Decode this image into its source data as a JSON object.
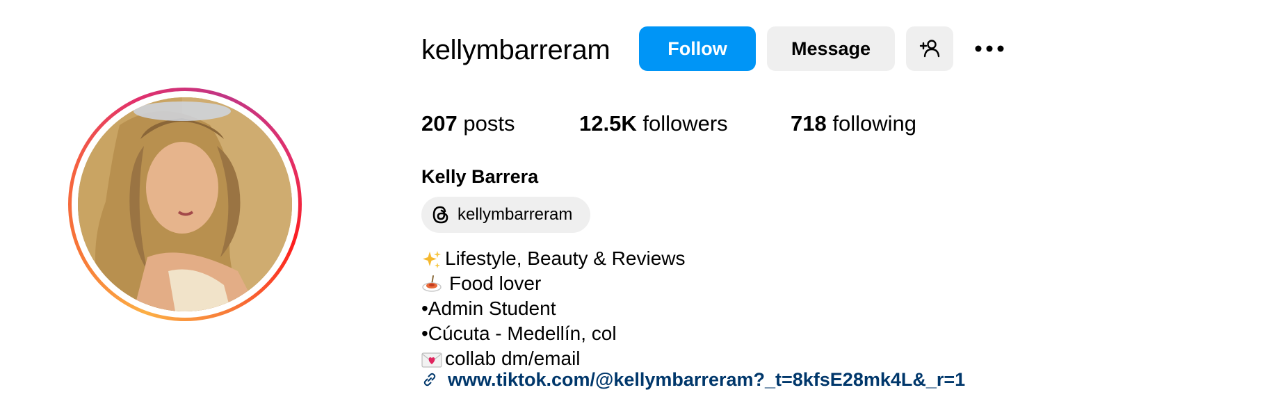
{
  "profile": {
    "username": "kellymbarreram",
    "full_name": "Kelly Barrera",
    "threads_handle": "kellymbarreram"
  },
  "actions": {
    "follow_label": "Follow",
    "message_label": "Message"
  },
  "stats": {
    "posts_count": "207",
    "posts_label": "posts",
    "followers_count": "12.5K",
    "followers_label": "followers",
    "following_count": "718",
    "following_label": "following"
  },
  "bio": {
    "line1": "Lifestyle, Beauty & Reviews",
    "line2": "Food lover",
    "line3": "•Admin Student",
    "line4": "•Cúcuta - Medellín, col",
    "line5": "collab dm/email",
    "link": "www.tiktok.com/@kellymbarreram?_t=8kfsE28mk4L&_r=1"
  },
  "icons": {
    "line1": "sparkles-icon",
    "line2": "spaghetti-icon",
    "line5": "love-letter-icon",
    "link": "link-icon",
    "threads": "threads-icon",
    "add_user": "add-user-icon",
    "more": "more-options-icon"
  },
  "colors": {
    "follow_button": "#0095f6",
    "secondary_button": "#efefef",
    "link": "#00376b",
    "story_ring_start": "#fcaf45",
    "story_ring_end": "#c13584"
  }
}
